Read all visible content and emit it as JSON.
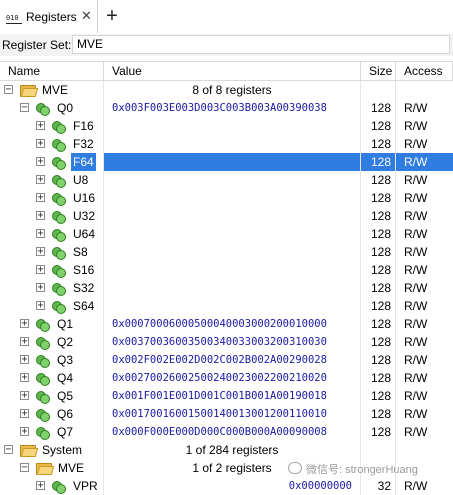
{
  "tab": {
    "icon": "010",
    "title": "Registers",
    "close": "✕"
  },
  "add_tab": "+",
  "register_set": {
    "label": "Register Set:",
    "value": "MVE"
  },
  "columns": {
    "name": "Name",
    "value": "Value",
    "size": "Size",
    "access": "Access"
  },
  "rows": [
    {
      "name": "MVE",
      "value": "8 of 8 registers",
      "size": "",
      "access": "",
      "type": "group"
    },
    {
      "name": "Q0",
      "value": "0x003F003E003D003C003B003A00390038",
      "size": "128",
      "access": "R/W"
    },
    {
      "name": "F16",
      "value": "",
      "size": "128",
      "access": "R/W"
    },
    {
      "name": "F32",
      "value": "",
      "size": "128",
      "access": "R/W"
    },
    {
      "name": "F64",
      "value": "",
      "size": "128",
      "access": "R/W",
      "selected": true
    },
    {
      "name": "U8",
      "value": "",
      "size": "128",
      "access": "R/W"
    },
    {
      "name": "U16",
      "value": "",
      "size": "128",
      "access": "R/W"
    },
    {
      "name": "U32",
      "value": "",
      "size": "128",
      "access": "R/W"
    },
    {
      "name": "U64",
      "value": "",
      "size": "128",
      "access": "R/W"
    },
    {
      "name": "S8",
      "value": "",
      "size": "128",
      "access": "R/W"
    },
    {
      "name": "S16",
      "value": "",
      "size": "128",
      "access": "R/W"
    },
    {
      "name": "S32",
      "value": "",
      "size": "128",
      "access": "R/W"
    },
    {
      "name": "S64",
      "value": "",
      "size": "128",
      "access": "R/W"
    },
    {
      "name": "Q1",
      "value": "0x00070006000500040003000200010000",
      "size": "128",
      "access": "R/W"
    },
    {
      "name": "Q2",
      "value": "0x00370036003500340033003200310030",
      "size": "128",
      "access": "R/W"
    },
    {
      "name": "Q3",
      "value": "0x002F002E002D002C002B002A00290028",
      "size": "128",
      "access": "R/W"
    },
    {
      "name": "Q4",
      "value": "0x00270026002500240023002200210020",
      "size": "128",
      "access": "R/W"
    },
    {
      "name": "Q5",
      "value": "0x001F001E001D001C001B001A00190018",
      "size": "128",
      "access": "R/W"
    },
    {
      "name": "Q6",
      "value": "0x00170016001500140013001200110010",
      "size": "128",
      "access": "R/W"
    },
    {
      "name": "Q7",
      "value": "0x000F000E000D000C000B000A00090008",
      "size": "128",
      "access": "R/W"
    },
    {
      "name": "System",
      "value": "1 of 284 registers",
      "size": "",
      "access": "",
      "type": "group"
    },
    {
      "name": "MVE",
      "value": "1 of 2 registers",
      "size": "",
      "access": "",
      "type": "group"
    },
    {
      "name": "VPR",
      "value": "0x00000000",
      "size": "32",
      "access": "R/W"
    }
  ],
  "watermark": "微信号: strongerHuang",
  "icons": {
    "folder": "folder-icon",
    "register": "register-icon",
    "expander": "expander-icon"
  }
}
